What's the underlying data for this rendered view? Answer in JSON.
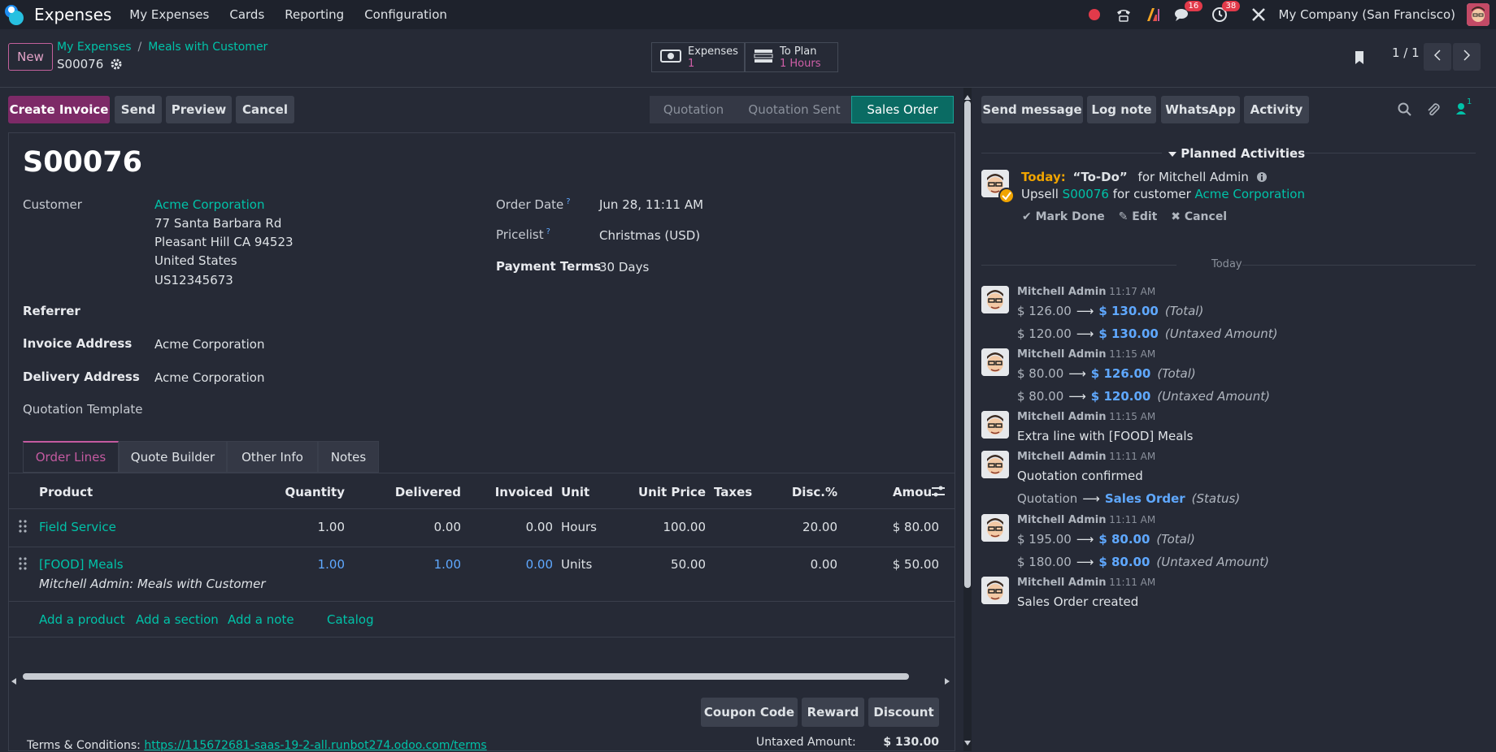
{
  "topbar": {
    "app_name": "Expenses",
    "menu": [
      "My Expenses",
      "Cards",
      "Reporting",
      "Configuration"
    ],
    "chat_count": "16",
    "activity_count": "38",
    "company": "My Company (San Francisco)"
  },
  "control": {
    "new_label": "New",
    "breadcrumb": [
      "My Expenses",
      "Meals with Customer"
    ],
    "record_name": "S00076",
    "smart_expenses_label": "Expenses",
    "smart_expenses_value": "1",
    "smart_plan_label": "To Plan",
    "smart_plan_value": "1 Hours",
    "pager": "1 / 1"
  },
  "actions": [
    "Create Invoice",
    "Send",
    "Preview",
    "Cancel"
  ],
  "statusbar": [
    "Quotation",
    "Quotation Sent",
    "Sales Order"
  ],
  "form": {
    "title": "S00076",
    "customer_label": "Customer",
    "customer_name": "Acme Corporation",
    "address": [
      "77 Santa Barbara Rd",
      "Pleasant Hill CA 94523",
      "United States",
      "US12345673"
    ],
    "referrer_label": "Referrer",
    "invoice_address_label": "Invoice Address",
    "invoice_address": "Acme Corporation",
    "delivery_address_label": "Delivery Address",
    "delivery_address": "Acme Corporation",
    "quotation_template_label": "Quotation Template",
    "order_date_label": "Order Date",
    "order_date": "Jun 28, 11:11 AM",
    "pricelist_label": "Pricelist",
    "pricelist": "Christmas (USD)",
    "payment_terms_label": "Payment Terms",
    "payment_terms": "30 Days",
    "help_mark": "?"
  },
  "tabs": [
    "Order Lines",
    "Quote Builder",
    "Other Info",
    "Notes"
  ],
  "order_lines": {
    "headers": [
      "Product",
      "Quantity",
      "Delivered",
      "Invoiced",
      "Unit",
      "Unit Price",
      "Taxes",
      "Disc.%",
      "Amou"
    ],
    "rows": [
      {
        "product": "Field Service",
        "qty": "1.00",
        "delivered": "0.00",
        "invoiced": "0.00",
        "unit": "Hours",
        "price": "100.00",
        "taxes": "",
        "disc": "20.00",
        "amount": "$ 80.00",
        "note": ""
      },
      {
        "product": "[FOOD] Meals",
        "qty": "1.00",
        "delivered": "1.00",
        "invoiced": "0.00",
        "unit": "Units",
        "price": "50.00",
        "taxes": "",
        "disc": "0.00",
        "amount": "$ 50.00",
        "note": "Mitchell Admin: Meals with Customer"
      }
    ],
    "add_links": [
      "Add a product",
      "Add a section",
      "Add a note",
      "Catalog"
    ]
  },
  "footer": {
    "buttons": [
      "Coupon Code",
      "Reward",
      "Discount"
    ],
    "terms_label": "Terms & Conditions:",
    "terms_url": "https://115672681-saas-19-2-all.runbot274.odoo.com/terms",
    "untaxed_label": "Untaxed Amount:",
    "untaxed_value": "$ 130.00"
  },
  "chatter": {
    "buttons": [
      "Send message",
      "Log note",
      "WhatsApp",
      "Activity"
    ],
    "followers_count": "1",
    "planned_title": "Planned Activities",
    "activity": {
      "today": "Today:",
      "name": "“To-Do”",
      "for": "for Mitchell Admin",
      "line_prefix": "Upsell",
      "order": "S00076",
      "line_mid": "for customer",
      "customer": "Acme Corporation",
      "mark_done": "Mark Done",
      "edit": "Edit",
      "cancel": "Cancel"
    },
    "divider": "Today",
    "messages": [
      {
        "author": "Mitchell Admin",
        "time": "11:17 AM",
        "lines": [
          {
            "from": "$ 126.00",
            "to": "$ 130.00",
            "field": "(Total)"
          },
          {
            "from": "$ 120.00",
            "to": "$ 130.00",
            "field": "(Untaxed Amount)"
          }
        ]
      },
      {
        "author": "Mitchell Admin",
        "time": "11:15 AM",
        "lines": [
          {
            "from": "$ 80.00",
            "to": "$ 126.00",
            "field": "(Total)"
          },
          {
            "from": "$ 80.00",
            "to": "$ 120.00",
            "field": "(Untaxed Amount)"
          }
        ]
      },
      {
        "author": "Mitchell Admin",
        "time": "11:15 AM",
        "text": "Extra line with [FOOD] Meals"
      },
      {
        "author": "Mitchell Admin",
        "time": "11:11 AM",
        "text": "Quotation confirmed",
        "lines": [
          {
            "from": "Quotation",
            "to": "Sales Order",
            "field": "(Status)"
          }
        ]
      },
      {
        "author": "Mitchell Admin",
        "time": "11:11 AM",
        "lines": [
          {
            "from": "$ 195.00",
            "to": "$ 80.00",
            "field": "(Total)"
          },
          {
            "from": "$ 180.00",
            "to": "$ 80.00",
            "field": "(Untaxed Amount)"
          }
        ]
      },
      {
        "author": "Mitchell Admin",
        "time": "11:11 AM",
        "text": "Sales Order created"
      }
    ]
  }
}
